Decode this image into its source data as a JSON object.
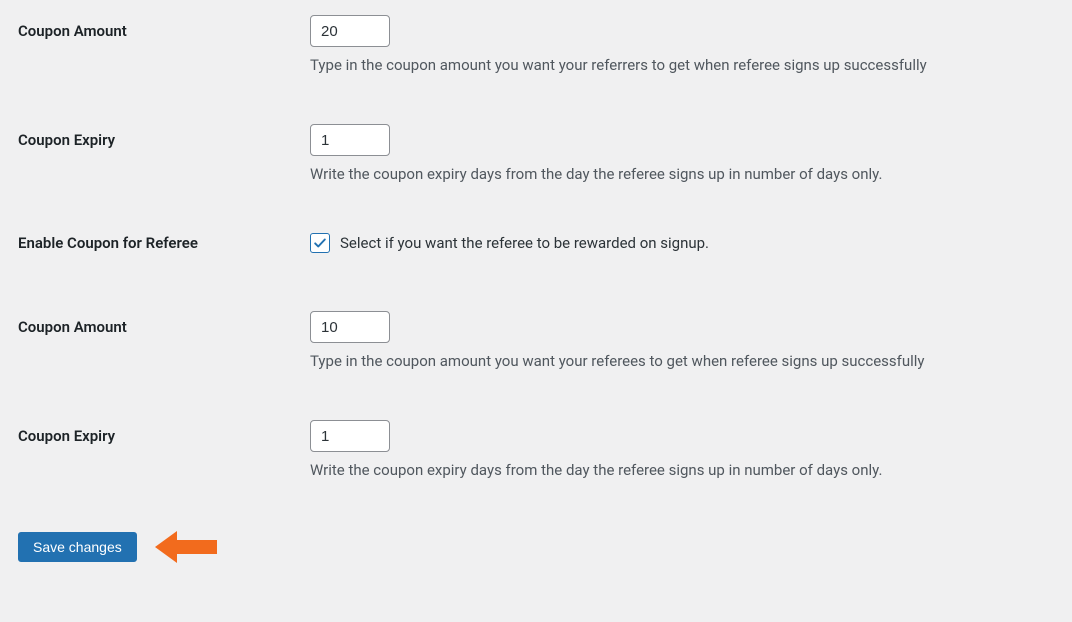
{
  "fields": {
    "referrer_coupon_amount": {
      "label": "Coupon Amount",
      "value": "20",
      "description": "Type in the coupon amount you want your referrers to get when referee signs up successfully"
    },
    "referrer_coupon_expiry": {
      "label": "Coupon Expiry",
      "value": "1",
      "description": "Write the coupon expiry days from the day the referee signs up in number of days only."
    },
    "enable_referee_coupon": {
      "label": "Enable Coupon for Referee",
      "checked": true,
      "text": "Select if you want the referee to be rewarded on signup."
    },
    "referee_coupon_amount": {
      "label": "Coupon Amount",
      "value": "10",
      "description": "Type in the coupon amount you want your referees to get when referee signs up successfully"
    },
    "referee_coupon_expiry": {
      "label": "Coupon Expiry",
      "value": "1",
      "description": "Write the coupon expiry days from the day the referee signs up in number of days only."
    }
  },
  "actions": {
    "save_label": "Save changes"
  },
  "colors": {
    "primary": "#2271b1",
    "arrow": "#f26b1d"
  }
}
